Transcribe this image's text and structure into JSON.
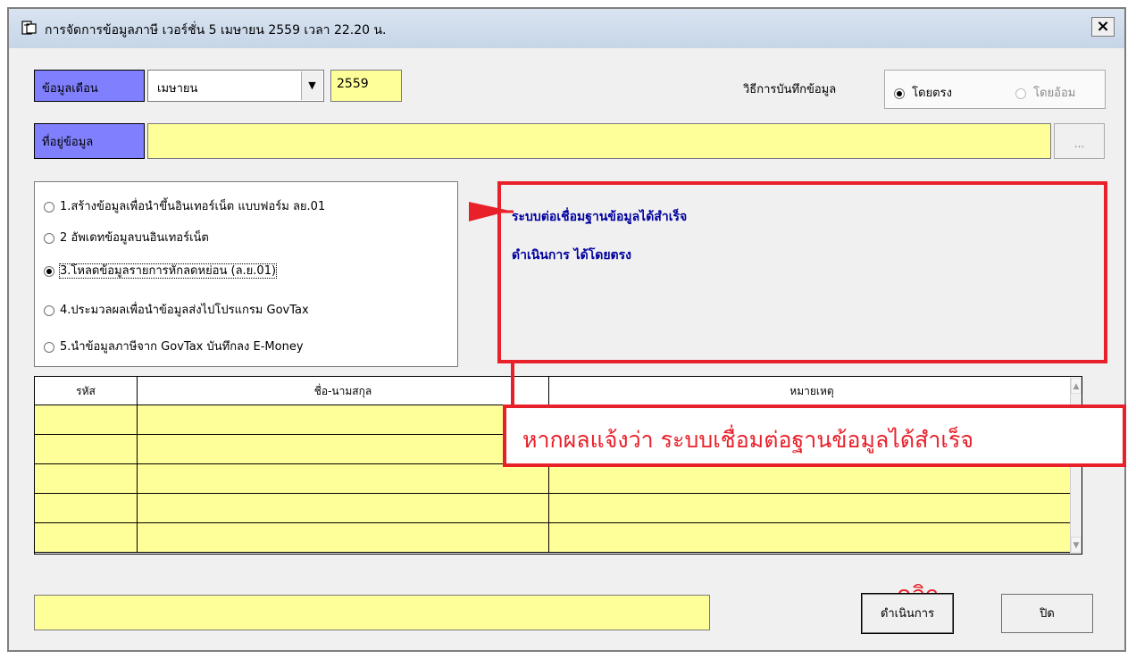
{
  "window": {
    "title": "การจัดการข้อมูลภาษี  เวอร์ชั่น 5 เมษายน 2559 เวลา 22.20 น.",
    "close_label": "×"
  },
  "month_section": {
    "label": "ข้อมูลเดือน",
    "month": "เมษายน",
    "year": "2559"
  },
  "save_mode": {
    "label": "วิธีการบันทึกข้อมูล",
    "options": [
      {
        "label": "โดยตรง",
        "selected": true,
        "enabled": true
      },
      {
        "label": "โดยอ้อม",
        "selected": false,
        "enabled": false
      }
    ]
  },
  "path_section": {
    "label": "ที่อยู่ข้อมูล",
    "value": "",
    "browse_label": "..."
  },
  "operations": [
    {
      "label": "1.สร้างข้อมูลเพื่อนำขึ้นอินเทอร์เน็ต แบบฟอร์ม ลย.01",
      "selected": false
    },
    {
      "label": "2 อัพเดทข้อมูลบนอินเทอร์เน็ต",
      "selected": false
    },
    {
      "label": "3.โหลดข้อมูลรายการหักลดหย่อน (ล.ย.01)",
      "selected": true
    },
    {
      "label": "4.ประมวลผลเพื่อนำข้อมูลส่งไปโปรแกรม GovTax",
      "selected": false
    },
    {
      "label": "5.นำข้อมูลภาษีจาก GovTax บันทึกลง E-Money",
      "selected": false
    }
  ],
  "messages": [
    "ระบบต่อเชื่อมฐานข้อมูลได้สำเร็จ",
    "ดำเนินการ ได้โดยตรง"
  ],
  "annotation": {
    "callout": "หากผลแจ้งว่า ระบบเชื่อมต่อฐานข้อมูลได้สำเร็จ",
    "click_label": "คลิก",
    "accent_color": "#e8202a"
  },
  "grid": {
    "columns": [
      "รหัส",
      "ชื่อ-นามสกุล",
      "หมายเหตุ"
    ],
    "rows": [
      [
        "",
        "",
        ""
      ],
      [
        "",
        "",
        ""
      ],
      [
        "",
        "",
        ""
      ],
      [
        "",
        "",
        ""
      ],
      [
        "",
        "",
        ""
      ]
    ]
  },
  "status_text": "",
  "buttons": {
    "run": "ดำเนินการ",
    "close": "ปิด"
  },
  "colors": {
    "label_blue": "#8080ff",
    "field_yellow": "#ffff99",
    "message_blue": "#0000a0"
  }
}
